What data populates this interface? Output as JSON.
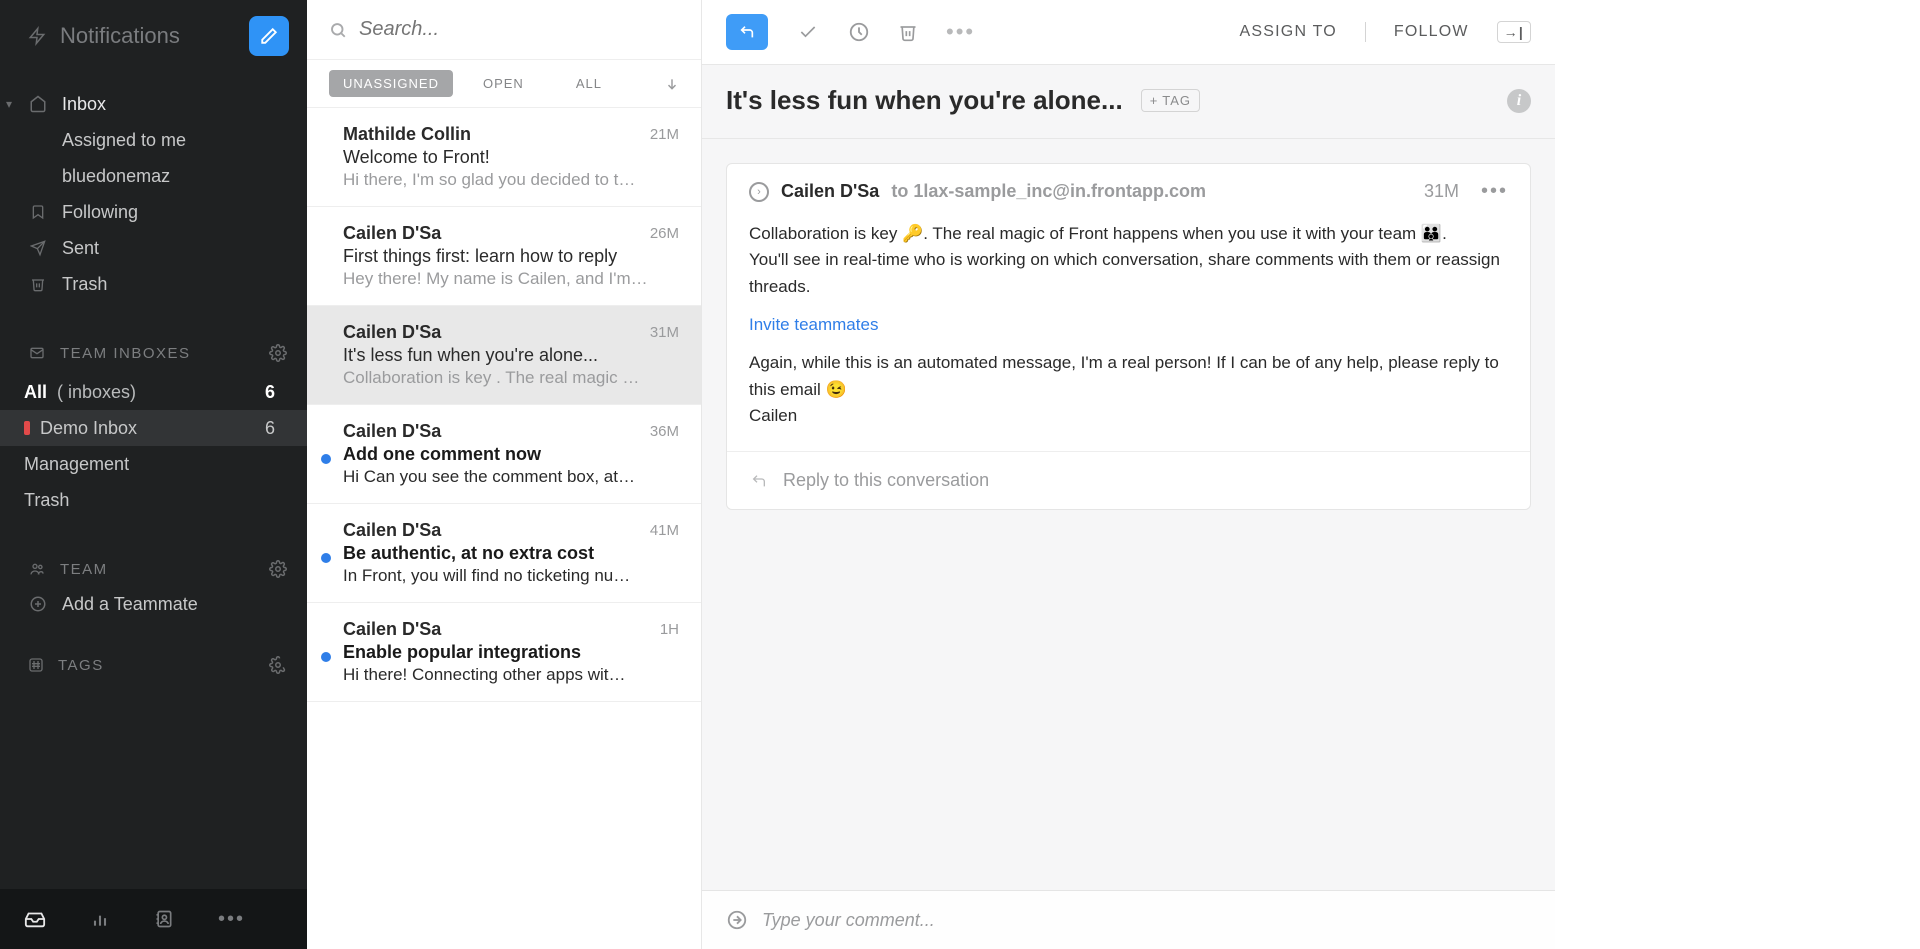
{
  "sidebar": {
    "title": "Notifications",
    "inbox": {
      "label": "Inbox",
      "children": [
        "Assigned to me",
        "bluedonemaz"
      ]
    },
    "following": "Following",
    "sent": "Sent",
    "trash": "Trash",
    "team_inboxes_header": "TEAM INBOXES",
    "team_inboxes": [
      {
        "label_a": "All",
        "label_b": "( inboxes)",
        "count": "6"
      },
      {
        "label_a": "Demo Inbox",
        "label_b": "",
        "count": "6"
      },
      {
        "label_a": "Management",
        "label_b": "",
        "count": ""
      },
      {
        "label_a": "Trash",
        "label_b": "",
        "count": ""
      }
    ],
    "team_header": "TEAM",
    "add_teammate": "Add a Teammate",
    "tags_header": "TAGS"
  },
  "list": {
    "search_placeholder": "Search...",
    "filters": {
      "unassigned": "UNASSIGNED",
      "open": "OPEN",
      "all": "ALL"
    },
    "items": [
      {
        "sender": "Mathilde Collin",
        "time": "21M",
        "subject": "Welcome to Front!",
        "preview": "Hi there, I'm so glad you decided to t…",
        "unread": false,
        "dot": false
      },
      {
        "sender": "Cailen D'Sa",
        "time": "26M",
        "subject": "First things first: learn how to reply",
        "preview": "Hey there! My name is Cailen, and I'm…",
        "unread": false,
        "dot": false
      },
      {
        "sender": "Cailen D'Sa",
        "time": "31M",
        "subject": "It's less fun when you're alone...",
        "preview": "Collaboration is key . The real magic …",
        "unread": false,
        "dot": false
      },
      {
        "sender": "Cailen D'Sa",
        "time": "36M",
        "subject": "Add one comment now",
        "preview": "Hi Can you see the comment box, at…",
        "unread": true,
        "dot": true
      },
      {
        "sender": "Cailen D'Sa",
        "time": "41M",
        "subject": "Be authentic, at no extra cost",
        "preview": "In Front, you will find no ticketing nu…",
        "unread": true,
        "dot": true
      },
      {
        "sender": "Cailen D'Sa",
        "time": "1H",
        "subject": "Enable popular integrations",
        "preview": "Hi there! Connecting other apps wit…",
        "unread": true,
        "dot": true
      }
    ],
    "selected_index": 2
  },
  "message": {
    "toolbar_right": {
      "assign": "ASSIGN TO",
      "follow": "FOLLOW"
    },
    "subject": "It's less fun when you're alone...",
    "tag_label": "TAG",
    "from": "Cailen D'Sa",
    "to_prefix": "to ",
    "to": "1lax-sample_inc@in.frontapp.com",
    "time": "31M",
    "body_line1": "Collaboration is key 🔑. The real magic of Front happens when you use it with your team 👪.",
    "body_line2": "You'll see in real-time who is working on which conversation, share comments with them or reassign threads.",
    "invite_link": "Invite teammates",
    "body_line3": "Again, while this is an automated message, I'm a real person! If I can be of any help, please reply to this email 😉",
    "sig": "Cailen",
    "reply_prompt": "Reply to this conversation",
    "comment_placeholder": "Type your comment..."
  }
}
